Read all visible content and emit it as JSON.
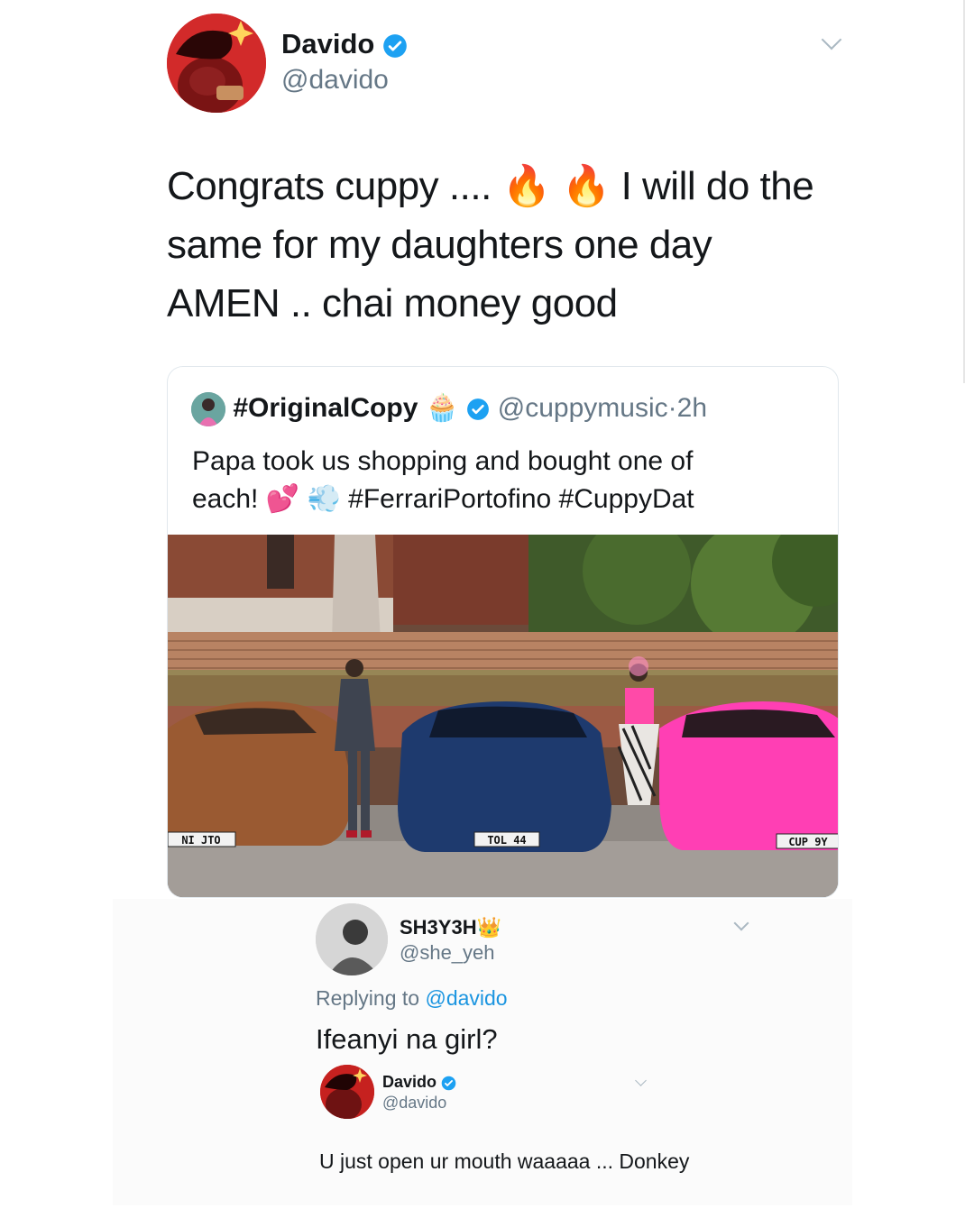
{
  "main_tweet": {
    "display_name": "Davido",
    "handle": "@davido",
    "text_before_emoji": "Congrats cuppy .... ",
    "emoji_1": "🔥",
    "emoji_2": "🔥",
    "text_after_emoji": " I will do the same for my daughters one day AMEN .. chai money good"
  },
  "quoted_tweet": {
    "display_name": "#OriginalCopy",
    "name_emoji": "🧁",
    "handle": "@cuppymusic",
    "separator": "·",
    "time": "2h",
    "text_line1": "Papa took us shopping and bought one of",
    "text_line2_prefix": "each! ",
    "heart_emoji": "💕",
    "dash_emoji": "💨",
    "hashtags": " #FerrariPortofino  #CuppyDat",
    "plates": [
      "NI JTO",
      "TOL 44",
      "CUP 9Y"
    ]
  },
  "reply_1": {
    "display_name": "SH3Y3H",
    "name_emoji": "👑",
    "handle": "@she_yeh",
    "replying_prefix": "Replying to ",
    "replying_to": "@davido",
    "text": "Ifeanyi na girl?"
  },
  "reply_2": {
    "display_name": "Davido",
    "handle": "@davido",
    "text": "U just open ur mouth waaaaa ... Donkey"
  },
  "colors": {
    "verified_blue": "#1da1f2",
    "link_blue": "#1b95e0",
    "secondary_text": "#657786",
    "car_brown": "#9a5a32",
    "car_blue": "#1e3a6e",
    "car_pink": "#ff3fb4"
  }
}
